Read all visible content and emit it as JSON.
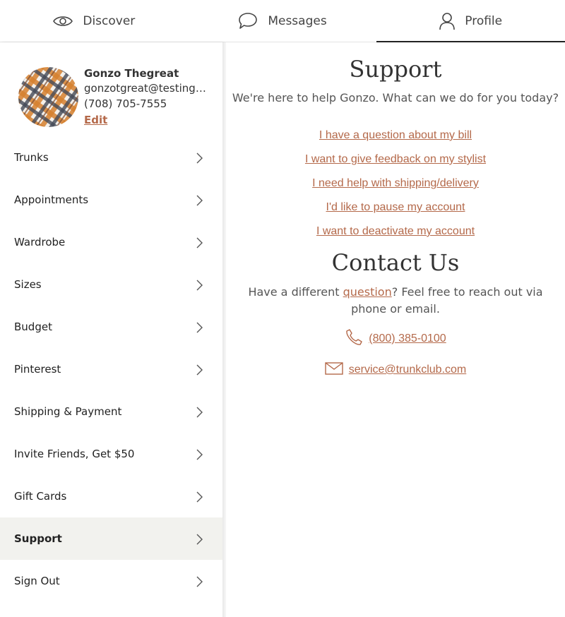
{
  "nav": {
    "tabs": [
      {
        "label": "Discover",
        "icon": "eye-icon"
      },
      {
        "label": "Messages",
        "icon": "chat-bubble-icon"
      },
      {
        "label": "Profile",
        "icon": "person-icon",
        "active": true
      }
    ]
  },
  "profile": {
    "name": "Gonzo Thegreat",
    "email": "gonzotgreat@testing....",
    "phone": "(708) 705-7555",
    "edit_label": "Edit"
  },
  "sidebar": {
    "items": [
      {
        "label": "Trunks"
      },
      {
        "label": "Appointments"
      },
      {
        "label": "Wardrobe"
      },
      {
        "label": "Sizes"
      },
      {
        "label": "Budget"
      },
      {
        "label": "Pinterest"
      },
      {
        "label": "Shipping & Payment"
      },
      {
        "label": "Invite Friends, Get $50"
      },
      {
        "label": "Gift Cards"
      },
      {
        "label": "Support",
        "active": true
      },
      {
        "label": "Sign Out"
      }
    ]
  },
  "support": {
    "title": "Support",
    "lead": "We're here to help Gonzo. What can we do for you today?",
    "links": [
      "I have a question about my bill",
      "I want to give feedback on my stylist",
      "I need help with shipping/delivery",
      "I'd like to pause my account",
      "I want to deactivate my account"
    ]
  },
  "contact": {
    "title": "Contact Us",
    "text_before": "Have a different ",
    "text_link": "question",
    "text_after": "? Feel free to reach out via phone or email.",
    "phone": "(800) 385-0100",
    "email": "service@trunkclub.com"
  },
  "colors": {
    "accent": "#b4694a",
    "active_bg": "#f2f2ee"
  }
}
